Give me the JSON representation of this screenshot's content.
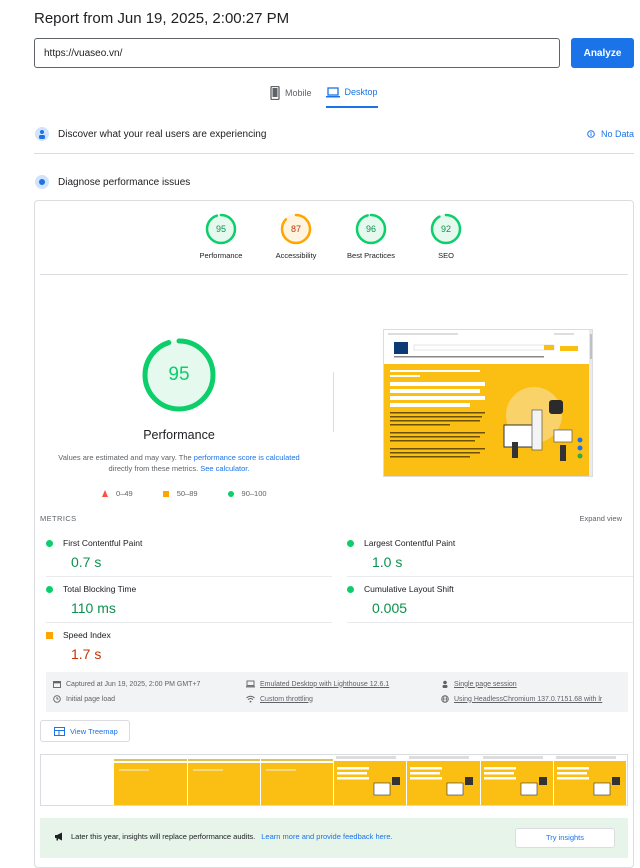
{
  "report": {
    "title": "Report from Jun 19, 2025, 2:00:27 PM"
  },
  "url_bar": {
    "value": "https://vuaseo.vn/",
    "button_label": "Analyze"
  },
  "tabs": [
    {
      "label": "Mobile",
      "icon": "phone-icon",
      "active": false
    },
    {
      "label": "Desktop",
      "icon": "laptop-icon",
      "active": true
    }
  ],
  "sections": {
    "real_users": {
      "label": "Discover what your real users are experiencing",
      "status": "No Data"
    },
    "diagnose": {
      "label": "Diagnose performance issues"
    }
  },
  "scores": [
    {
      "label": "Performance",
      "value": "95",
      "color": "#0cce6b"
    },
    {
      "label": "Accessibility",
      "value": "87",
      "color": "#ffa400"
    },
    {
      "label": "Best Practices",
      "value": "96",
      "color": "#0cce6b"
    },
    {
      "label": "SEO",
      "value": "92",
      "color": "#0cce6b"
    }
  ],
  "performance": {
    "score": "95",
    "title": "Performance",
    "note_prefix": "Values are estimated and may vary. The",
    "note_link1": "performance score is calculated",
    "note_middle": "directly from these metrics.",
    "note_link2": "See calculator."
  },
  "legend": {
    "poor": "0–49",
    "average": "50–89",
    "good": "90–100"
  },
  "metrics": {
    "label": "METRICS",
    "expand": "Expand view",
    "items": [
      {
        "name": "First Contentful Paint",
        "value": "0.7 s",
        "rating": "good"
      },
      {
        "name": "Largest Contentful Paint",
        "value": "1.0 s",
        "rating": "good"
      },
      {
        "name": "Total Blocking Time",
        "value": "110 ms",
        "rating": "good"
      },
      {
        "name": "Cumulative Layout Shift",
        "value": "0.005",
        "rating": "good"
      },
      {
        "name": "Speed Index",
        "value": "1.7 s",
        "rating": "average"
      }
    ]
  },
  "env_info": {
    "captured": "Captured at Jun 19, 2025, 2:00 PM GMT+7",
    "emulated": "Emulated Desktop with Lighthouse 12.6.1",
    "session": "Single page session",
    "load": "Initial page load",
    "throttling": "Custom throttling",
    "browser": "Using HeadlessChromium 137.0.7151.68 with lr"
  },
  "treemap": {
    "label": "View Treemap"
  },
  "banner": {
    "text": "Later this year, insights will replace performance audits.",
    "link": "Learn more and provide feedback here.",
    "button": "Try insights"
  },
  "colors": {
    "good": "#0cce6b",
    "average": "#ffa400",
    "poor": "#ff4e42",
    "accent": "#1a73e8",
    "site_yellow": "#fbbf14"
  }
}
